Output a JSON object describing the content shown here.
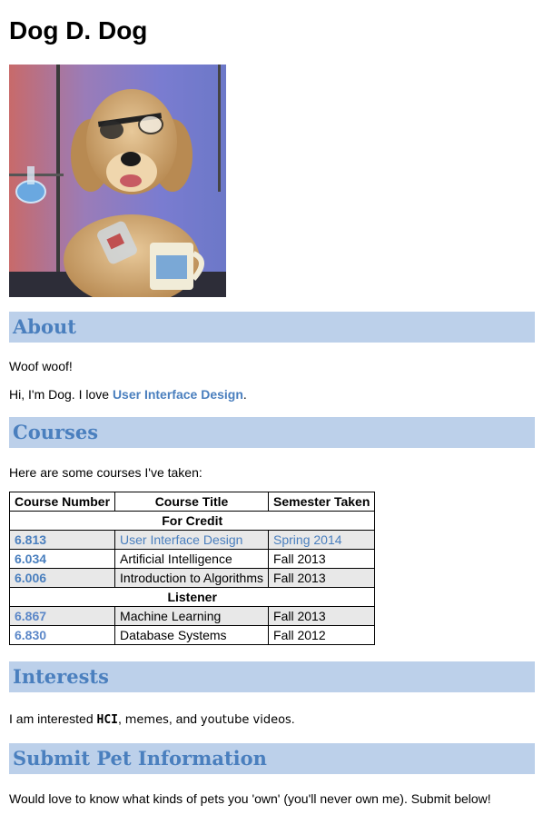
{
  "title": "Dog D. Dog",
  "photo_alt": "dog-in-lab-photo",
  "about": {
    "heading": "About",
    "line1": "Woof woof!",
    "line2_prefix": "Hi, I'm Dog. I love ",
    "line2_link": "User Interface Design",
    "line2_suffix": "."
  },
  "courses": {
    "heading": "Courses",
    "intro": "Here are some courses I've taken:",
    "columns": [
      "Course Number",
      "Course Title",
      "Semester Taken"
    ],
    "groups": [
      {
        "label": "For Credit",
        "rows": [
          {
            "number": "6.813",
            "title": "User Interface Design",
            "semester": "Spring 2014"
          },
          {
            "number": "6.034",
            "title": "Artificial Intelligence",
            "semester": "Fall 2013"
          },
          {
            "number": "6.006",
            "title": "Introduction to Algorithms",
            "semester": "Fall 2013"
          }
        ]
      },
      {
        "label": "Listener",
        "rows": [
          {
            "number": "6.867",
            "title": "Machine Learning",
            "semester": "Fall 2013"
          },
          {
            "number": "6.830",
            "title": "Database Systems",
            "semester": "Fall 2012"
          }
        ]
      }
    ]
  },
  "interests": {
    "heading": "Interests",
    "prefix": "I am interested ",
    "item1": "HCI",
    "sep1": ", ",
    "item2": "memes",
    "sep2": ", and ",
    "item3": "youtube videos",
    "suffix": "."
  },
  "submit": {
    "heading": "Submit Pet Information",
    "text": "Would love to know what kinds of pets you 'own' (you'll never own me). Submit below!"
  },
  "colors": {
    "section_bg": "#bcd0ea",
    "accent": "#4a7fbe",
    "row_shade": "#e8e8e8"
  }
}
